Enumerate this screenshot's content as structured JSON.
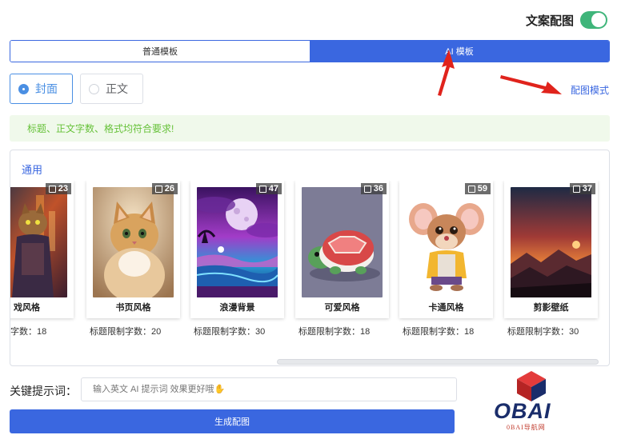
{
  "header": {
    "toggle_label": "文案配图",
    "toggle_on": true,
    "accent": "#3fb57a"
  },
  "tabs": [
    {
      "label": "普通模板",
      "active": false
    },
    {
      "label": "AI 模板",
      "active": true
    }
  ],
  "radios": [
    {
      "label": "封面",
      "checked": true
    },
    {
      "label": "正文",
      "checked": false
    }
  ],
  "mode_link": "配图模式",
  "alert": "标题、正文字数、格式均符合要求!",
  "panel": {
    "section_title": "通用",
    "cards": [
      {
        "name": "戏风格",
        "count": "23",
        "limit": "字数：18",
        "art": "cyber-cat"
      },
      {
        "name": "书页风格",
        "count": "26",
        "limit": "标题限制字数：20",
        "art": "fluffy-cat"
      },
      {
        "name": "浪漫背景",
        "count": "47",
        "limit": "标题限制字数：30",
        "art": "neon-sea"
      },
      {
        "name": "可爱风格",
        "count": "36",
        "limit": "标题限制字数：18",
        "art": "turtle"
      },
      {
        "name": "卡通风格",
        "count": "59",
        "limit": "标题限制字数：18",
        "art": "mouse"
      },
      {
        "name": "剪影壁纸",
        "count": "37",
        "limit": "标题限制字数：30",
        "art": "sunset"
      }
    ]
  },
  "prompt": {
    "label": "关键提示词：",
    "placeholder": "输入英文 AI 提示词 效果更好哦✋"
  },
  "generate_label": "生成配图",
  "logo": {
    "word": "OBAI",
    "sub": "0BAI导航网"
  },
  "colors": {
    "primary": "#3a67e0",
    "success_text": "#67c23a",
    "success_bg": "#f0f9eb",
    "arrow": "#e0231c"
  }
}
